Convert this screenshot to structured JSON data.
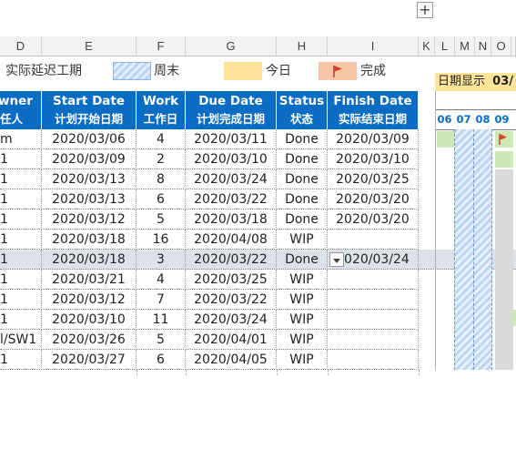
{
  "toolbar": {
    "expand_label": "+"
  },
  "columns": {
    "spreadsheet_cols": [
      "D",
      "E",
      "F",
      "G",
      "H",
      "I",
      "K",
      "L",
      "M",
      "N",
      "O"
    ]
  },
  "legend": {
    "delay_label": "实际延迟工期",
    "weekend_label": "周末",
    "today_label": "今日",
    "done_label": "完成",
    "colors": {
      "weekend": "#bcd6f2",
      "today": "#ffe49a",
      "done": "#f6c5a8"
    }
  },
  "gantt": {
    "display_label": "日期显示",
    "display_value": "03/",
    "days": [
      "06",
      "07",
      "08",
      "09"
    ]
  },
  "table": {
    "headers": [
      {
        "en": "wner",
        "zh": "任人"
      },
      {
        "en": "Start Date",
        "zh": "计划开始日期"
      },
      {
        "en": "Work",
        "zh": "工作日"
      },
      {
        "en": "Due Date",
        "zh": "计划完成日期"
      },
      {
        "en": "Status",
        "zh": "状态"
      },
      {
        "en": "Finish Date",
        "zh": "实际结束日期"
      }
    ],
    "rows": [
      {
        "owner": "m",
        "start": "2020/03/06",
        "work": "4",
        "due": "2020/03/11",
        "status": "Done",
        "finish": "2020/03/09"
      },
      {
        "owner": "1",
        "start": "2020/03/09",
        "work": "2",
        "due": "2020/03/10",
        "status": "Done",
        "finish": "2020/03/10"
      },
      {
        "owner": "1",
        "start": "2020/03/13",
        "work": "8",
        "due": "2020/03/24",
        "status": "Done",
        "finish": "2020/03/25"
      },
      {
        "owner": "1",
        "start": "2020/03/13",
        "work": "6",
        "due": "2020/03/22",
        "status": "Done",
        "finish": "2020/03/20"
      },
      {
        "owner": "1",
        "start": "2020/03/12",
        "work": "5",
        "due": "2020/03/18",
        "status": "Done",
        "finish": "2020/03/20"
      },
      {
        "owner": "1",
        "start": "2020/03/18",
        "work": "16",
        "due": "2020/04/08",
        "status": "WIP",
        "finish": ""
      },
      {
        "owner": "1",
        "start": "2020/03/18",
        "work": "3",
        "due": "2020/03/22",
        "status": "Done",
        "finish": "2020/03/24"
      },
      {
        "owner": "1",
        "start": "2020/03/21",
        "work": "4",
        "due": "2020/03/25",
        "status": "WIP",
        "finish": ""
      },
      {
        "owner": "1",
        "start": "2020/03/12",
        "work": "7",
        "due": "2020/03/22",
        "status": "WIP",
        "finish": ""
      },
      {
        "owner": "1",
        "start": "2020/03/10",
        "work": "11",
        "due": "2020/03/24",
        "status": "WIP",
        "finish": ""
      },
      {
        "owner": "l/SW1",
        "start": "2020/03/26",
        "work": "5",
        "due": "2020/04/01",
        "status": "WIP",
        "finish": ""
      },
      {
        "owner": "1",
        "start": "2020/03/27",
        "work": "6",
        "due": "2020/04/05",
        "status": "WIP",
        "finish": ""
      }
    ],
    "selected_row": 6
  }
}
